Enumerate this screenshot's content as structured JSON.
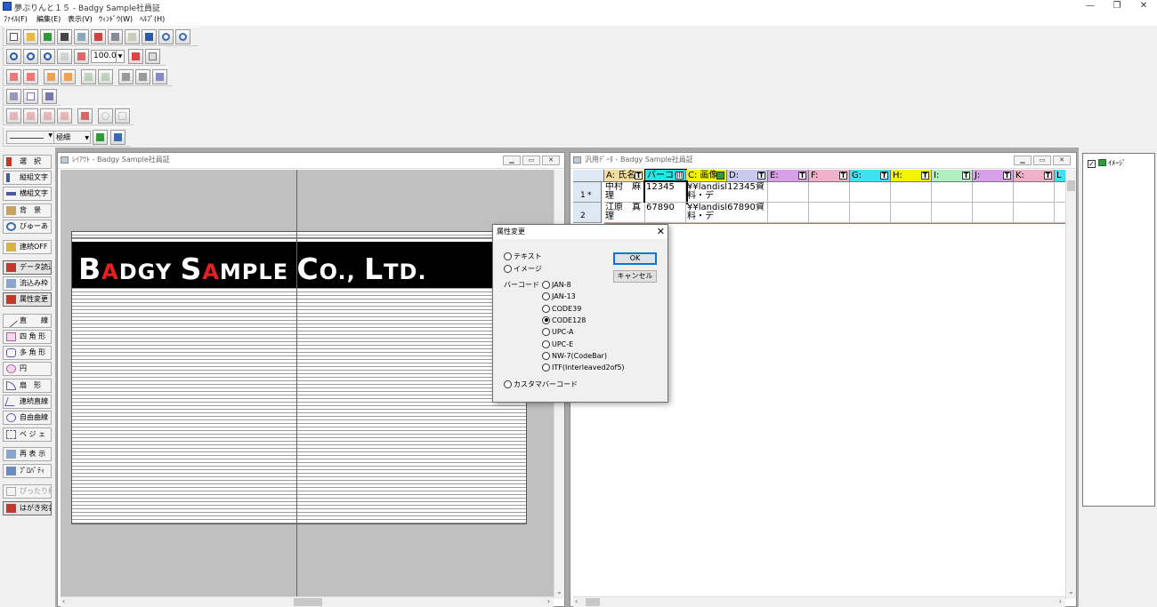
{
  "app": {
    "title": "夢ぷりんと１５ - Badgy Sample社員証",
    "controls": {
      "minimize": "—",
      "restore": "❐",
      "close": "✕"
    }
  },
  "menu": [
    "ﾌｧｲﾙ(F)",
    "編集(E)",
    "表示(V)",
    "ｳｨﾝﾄﾞｳ(W)",
    "ﾍﾙﾌﾟ(H)"
  ],
  "toolbar": {
    "zoom_value": "100.0",
    "line_style": "極細"
  },
  "palette": [
    {
      "label": "選　択",
      "icon": "select-arrow-icon",
      "color": "#c0392b"
    },
    {
      "label": "縦組文字",
      "icon": "vertical-text-icon",
      "color": "#4a5aa0"
    },
    {
      "label": "横組文字",
      "icon": "horizontal-text-icon",
      "color": "#4a5aa0"
    },
    {
      "label": "背　景",
      "icon": "background-icon",
      "color": "#8a6b2e"
    },
    {
      "label": "びゅーあ",
      "icon": "viewer-icon",
      "color": "#3a6fb0"
    },
    {
      "label": "連続OFF",
      "icon": "continuous-off-icon",
      "color": "#b08a2e"
    },
    {
      "label": "データ読込",
      "icon": "data-load-icon",
      "color": "#c0392b"
    },
    {
      "label": "流込み枠",
      "icon": "flow-frame-icon",
      "color": "#5a7ab0"
    },
    {
      "label": "属性変更",
      "icon": "attribute-change-icon",
      "color": "#c0392b"
    },
    {
      "label": "直　　線",
      "icon": "line-tool-icon",
      "color": "#555555"
    },
    {
      "label": "四 角 形",
      "icon": "rectangle-tool-icon",
      "color": "#b05aa0"
    },
    {
      "label": "多 角 形",
      "icon": "polygon-tool-icon",
      "color": "#5a5ab0"
    },
    {
      "label": "円",
      "icon": "circle-tool-icon",
      "color": "#b05aa0"
    },
    {
      "label": "扇　形",
      "icon": "sector-tool-icon",
      "color": "#5a5ab0"
    },
    {
      "label": "連続直線",
      "icon": "polyline-tool-icon",
      "color": "#5a5ab0"
    },
    {
      "label": "自由曲線",
      "icon": "freehand-tool-icon",
      "color": "#5a5ab0"
    },
    {
      "label": "ベ ジ ェ",
      "icon": "bezier-tool-icon",
      "color": "#5a5ab0"
    },
    {
      "label": "再 表 示",
      "icon": "redraw-icon",
      "color": "#3a6fb0"
    },
    {
      "label": "ﾌﾟﾛﾊﾟﾃｨ",
      "icon": "property-icon",
      "color": "#3a6fb0"
    },
    {
      "label": "ぴったり枠",
      "icon": "fit-frame-icon",
      "color": "#999999"
    },
    {
      "label": "はがき宛名",
      "icon": "postcard-address-icon",
      "color": "#c0392b"
    }
  ],
  "layout_window": {
    "title": "ﾚｲｱｳﾄ - Badgy Sample社員証",
    "brand_text": "BADGY SAMPLE CO., LTD.",
    "brand_parts": [
      {
        "t": "B",
        "c": "#ffffff",
        "big": true
      },
      {
        "t": "A",
        "c": "#e62020",
        "big": false
      },
      {
        "t": "DGY ",
        "c": "#ffffff",
        "big": false
      },
      {
        "t": "S",
        "c": "#ffffff",
        "big": true
      },
      {
        "t": "A",
        "c": "#e62020",
        "big": false
      },
      {
        "t": "MPLE ",
        "c": "#ffffff",
        "big": false
      },
      {
        "t": "C",
        "c": "#ffffff",
        "big": true
      },
      {
        "t": "O., ",
        "c": "#ffffff",
        "big": false
      },
      {
        "t": "L",
        "c": "#ffffff",
        "big": true
      },
      {
        "t": "TD.",
        "c": "#ffffff",
        "big": false
      }
    ]
  },
  "data_window": {
    "title": "汎用ﾃﾞｰﾀ - Badgy Sample社員証",
    "columns": [
      {
        "label": "A: 氏名",
        "bg": "#f6df9a",
        "type": "T"
      },
      {
        "label": "バーコー",
        "bg": "#22e6e6",
        "type": "|||"
      },
      {
        "label": "C: 画像",
        "bg": "#f4f400",
        "type": "img"
      },
      {
        "label": "D:",
        "bg": "#c8c8f0",
        "type": "T"
      },
      {
        "label": "E:",
        "bg": "#d8a0e8",
        "type": "T"
      },
      {
        "label": "F:",
        "bg": "#f0b0c8",
        "type": "T"
      },
      {
        "label": "G:",
        "bg": "#40e0f0",
        "type": "T"
      },
      {
        "label": "H:",
        "bg": "#f4f400",
        "type": "T"
      },
      {
        "label": "I:",
        "bg": "#b0f0c0",
        "type": "T"
      },
      {
        "label": "J:",
        "bg": "#d8a0e8",
        "type": "T"
      },
      {
        "label": "K:",
        "bg": "#f0b0c8",
        "type": "T"
      },
      {
        "label": "L",
        "bg": "#40e0f0",
        "type": ""
      }
    ],
    "rows": [
      {
        "num": "1",
        "mark": "*",
        "cells": [
          "中村　麻理",
          "12345",
          "¥¥landisl12345資料・デ"
        ]
      },
      {
        "num": "2",
        "mark": "",
        "cells": [
          "江原　真理",
          "67890",
          "¥¥landisl67890資料・デ"
        ]
      }
    ]
  },
  "dialog": {
    "title": "属性変更",
    "close": "✕",
    "option_text": "テキスト",
    "option_image": "イメージ",
    "barcode_label": "バーコード",
    "barcode_types": [
      {
        "label": "JAN-8",
        "selected": false
      },
      {
        "label": "JAN-13",
        "selected": false
      },
      {
        "label": "CODE39",
        "selected": false
      },
      {
        "label": "CODE128",
        "selected": true
      },
      {
        "label": "UPC-A",
        "selected": false
      },
      {
        "label": "UPC-E",
        "selected": false
      },
      {
        "label": "NW-7(CodeBar)",
        "selected": false
      },
      {
        "label": "ITF(Interleaved2of5)",
        "selected": false
      }
    ],
    "option_custom": "カスタマバーコード",
    "ok": "OK",
    "cancel": "キャンセル"
  },
  "right_panel": {
    "item": "ｲﾒｰｼﾞ",
    "checked": true
  }
}
